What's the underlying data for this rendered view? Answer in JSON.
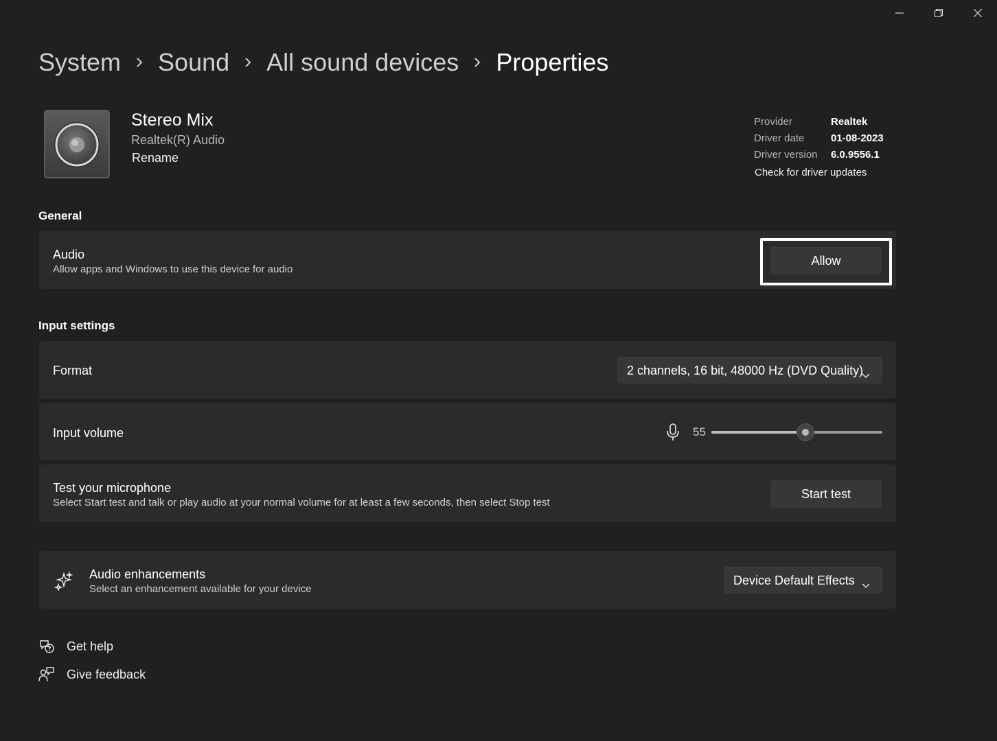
{
  "window": {
    "minimize_icon": "minimize-icon",
    "restore_icon": "restore-icon",
    "close_icon": "close-icon"
  },
  "breadcrumb": [
    "System",
    "Sound",
    "All sound devices",
    "Properties"
  ],
  "device": {
    "name": "Stereo Mix",
    "subtitle": "Realtek(R) Audio",
    "rename_label": "Rename",
    "icon": "speaker-icon"
  },
  "driver": {
    "provider_label": "Provider",
    "provider_value": "Realtek",
    "date_label": "Driver date",
    "date_value": "01-08-2023",
    "version_label": "Driver version",
    "version_value": "6.0.9556.1",
    "update_link": "Check for driver updates"
  },
  "general": {
    "section_title": "General",
    "audio_title": "Audio",
    "audio_desc": "Allow apps and Windows to use this device for audio",
    "allow_label": "Allow"
  },
  "input_settings": {
    "section_title": "Input settings",
    "format_title": "Format",
    "format_value": "2 channels, 16 bit, 48000 Hz (DVD Quality)",
    "volume_title": "Input volume",
    "volume_value": "55",
    "volume_level": 0.55,
    "test_title": "Test your microphone",
    "test_desc": "Select Start test and talk or play audio at your normal volume for at least a few seconds, then select Stop test",
    "test_button": "Start test"
  },
  "enhancements": {
    "title": "Audio enhancements",
    "desc": "Select an enhancement available for your device",
    "value": "Device Default Effects",
    "icon": "sparkle-icon"
  },
  "footer": {
    "help_label": "Get help",
    "feedback_label": "Give feedback"
  },
  "colors": {
    "background": "#202020",
    "card": "#2b2b2b",
    "button": "#373737"
  }
}
